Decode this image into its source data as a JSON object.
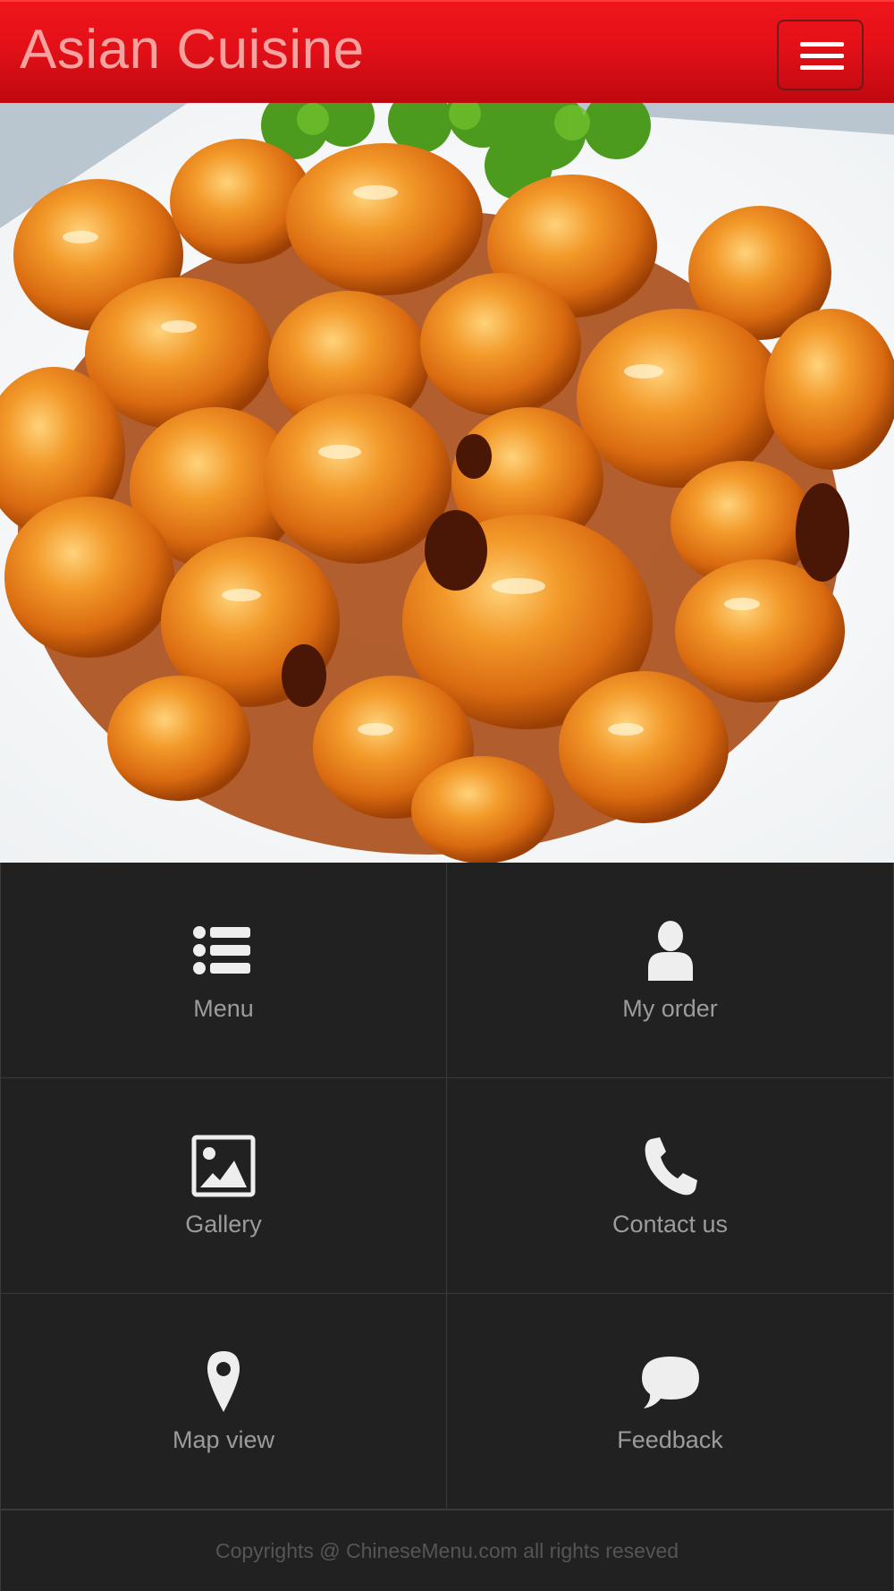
{
  "header": {
    "title": "Asian Cuisine",
    "menu_toggle_icon": "hamburger-icon",
    "colors": {
      "background": "#e31018",
      "title": "#f6a39f"
    }
  },
  "hero": {
    "image_subject": "orange chicken with broccoli on a white plate"
  },
  "tiles": [
    {
      "label": "Menu",
      "icon": "list-icon"
    },
    {
      "label": "My order",
      "icon": "user-icon"
    },
    {
      "label": "Gallery",
      "icon": "image-icon"
    },
    {
      "label": "Contact us",
      "icon": "phone-icon"
    },
    {
      "label": "Map view",
      "icon": "map-pin-icon"
    },
    {
      "label": "Feedback",
      "icon": "chat-bubble-icon"
    }
  ],
  "footer": {
    "copyright": "Copyrights @ ChineseMenu.com all rights reseved"
  },
  "colors": {
    "panel_background": "#212121",
    "tile_label": "#9c9c9c",
    "icon": "#eeeeee",
    "footer_text": "#555555"
  }
}
